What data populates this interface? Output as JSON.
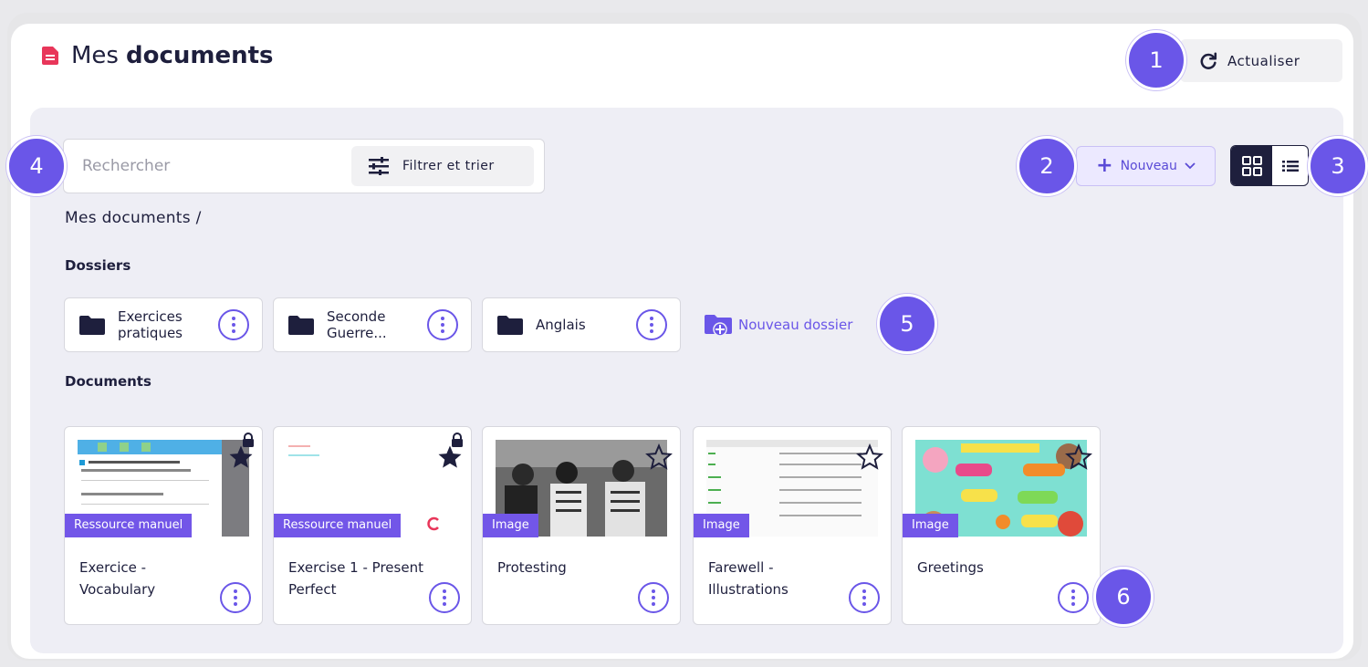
{
  "header": {
    "title_prefix": "Mes",
    "title_bold": "documents",
    "refresh_label": "Actualiser"
  },
  "search": {
    "placeholder": "Rechercher",
    "filter_label": "Filtrer et trier"
  },
  "toolbar": {
    "new_label": "Nouveau"
  },
  "breadcrumb": "Mes documents /",
  "folders_section": "Dossiers",
  "folders": [
    {
      "name": "Exercices pratiques"
    },
    {
      "name": "Seconde Guerre..."
    },
    {
      "name": "Anglais"
    }
  ],
  "new_folder_label": "Nouveau dossier",
  "documents_section": "Documents",
  "documents": [
    {
      "tag": "Ressource manuel",
      "name": "Exercice - Vocabulary",
      "favorite": true,
      "locked": true
    },
    {
      "tag": "Ressource manuel",
      "name": "Exercise 1 - Present Perfect",
      "favorite": true,
      "locked": true
    },
    {
      "tag": "Image",
      "name": "Protesting",
      "favorite": false,
      "locked": false
    },
    {
      "tag": "Image",
      "name": "Farewell - Illustrations",
      "favorite": false,
      "locked": false
    },
    {
      "tag": "Image",
      "name": "Greetings",
      "favorite": false,
      "locked": false
    }
  ],
  "badges": [
    "1",
    "2",
    "3",
    "4",
    "5",
    "6"
  ],
  "colors": {
    "accent": "#6a56e8",
    "navy": "#1e1f3d",
    "panel": "#eeeef5",
    "title_icon": "#e8365a"
  }
}
